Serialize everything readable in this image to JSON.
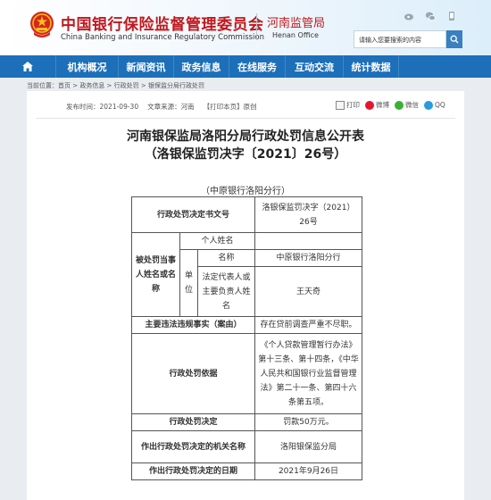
{
  "header": {
    "org_name_cn": "中国银行保险监督管理委员会",
    "org_name_en": "China Banking and Insurance Regulatory Commission",
    "office_cn": "河南监管局",
    "office_en": "Henan Office",
    "search_placeholder": "请输入您要搜索的内容"
  },
  "nav": {
    "items": [
      "机构概况",
      "新闻资讯",
      "政务信息",
      "在线服务",
      "互动交流",
      "统计数据"
    ]
  },
  "breadcrumb": "当前位置：首页 > 政务信息 > 行政处罚 > 银保监分局行政处罚",
  "article": {
    "publish_time": "发布时间：2021-09-30",
    "source": "文章来源：河南",
    "category": "【打印本页】原创",
    "share_print": "打印",
    "share_weibo": "微博",
    "share_wechat": "微信",
    "share_qq": "QQ",
    "title_line1": "河南银保监局洛阳分局行政处罚信息公开表",
    "title_line2": "（洛银保监罚决字〔2021〕26号）",
    "subject": "（中原银行洛阳分行）"
  },
  "table": {
    "doc_number_label": "行政处罚决定书文号",
    "doc_number_value": "洛银保监罚决字（2021）26号",
    "party_label": "被处罚当事人姓名或名称",
    "individual_label": "个人姓名",
    "unit_label": "单位",
    "name_label": "名称",
    "name_value": "中原银行洛阳分行",
    "rep_label": "法定代表人或主要负责人姓名",
    "rep_value": "王天奇",
    "violation_label": "主要违法违规事实（案由）",
    "violation_value": "存在贷前调查严重不尽职。",
    "basis_label": "行政处罚依据",
    "basis_value": "《个人贷款管理暂行办法》第十三条、第十四条，《中华人民共和国银行业监督管理法》第二十一条、第四十六条第五项。",
    "decision_label": "行政处罚决定",
    "decision_value": "罚款50万元。",
    "authority_label": "作出行政处罚决定的机关名称",
    "authority_value": "洛阳银保监分局",
    "date_label": "作出行政处罚决定的日期",
    "date_value": "2021年9月26日"
  }
}
